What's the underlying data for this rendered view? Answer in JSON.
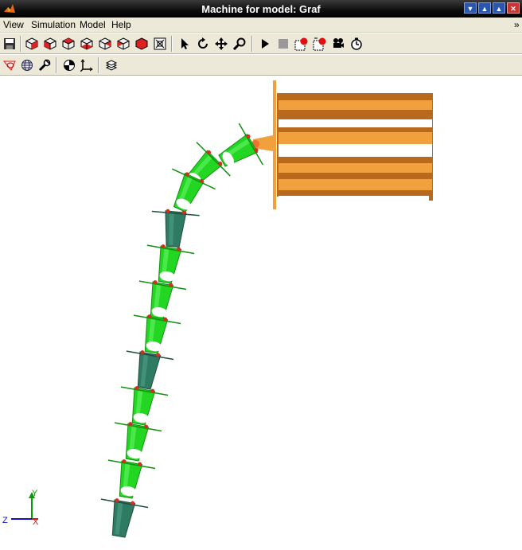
{
  "window": {
    "title": "Machine for model: Graf",
    "controls": [
      "▼",
      "▲",
      "▲",
      "✕"
    ]
  },
  "menu": {
    "items": [
      "View",
      "Simulation",
      "Model",
      "Help"
    ],
    "overflow": "»"
  },
  "toolbar1": {
    "icons": [
      "save-icon",
      "view-iso-icon",
      "view-front-icon",
      "view-side-icon",
      "view-top-icon",
      "view-bottom-icon",
      "view-back-icon",
      "view-right-icon",
      "fit-view-icon",
      "select-arrow-icon",
      "rotate-icon",
      "pan-icon",
      "zoom-icon",
      "play-icon",
      "stop-icon",
      "record-icon",
      "record-settings-icon",
      "camera-icon",
      "timer-icon"
    ]
  },
  "toolbar2": {
    "icons": [
      "ellipsoid-icon",
      "globe-icon",
      "tool-icon",
      "center-of-gravity-icon",
      "axes-icon",
      "layers-icon"
    ]
  },
  "scene": {
    "triad": {
      "x_label": "X",
      "y_label": "Y",
      "z_label": "Z"
    },
    "colors": {
      "link_green": "#22d622",
      "link_dark": "#2f7a62",
      "joint_red": "#d03020",
      "base_orange": "#f0a03c",
      "base_dark": "#b8691c"
    }
  }
}
